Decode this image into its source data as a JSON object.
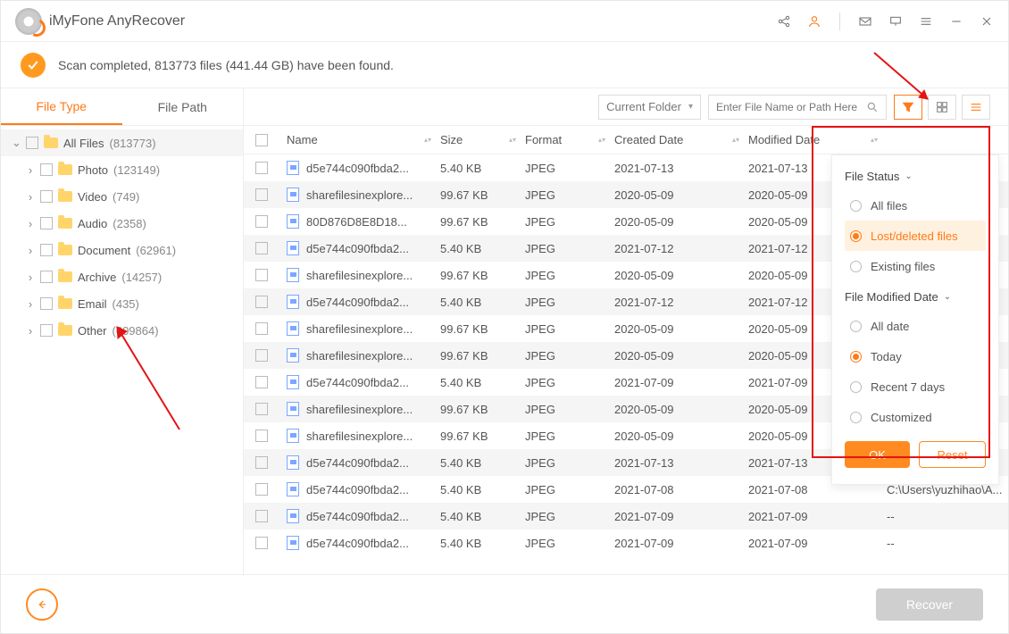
{
  "header": {
    "title": "iMyFone AnyRecover"
  },
  "status": {
    "text": "Scan completed, 813773 files (441.44 GB) have been found."
  },
  "tabs": {
    "fileType": "File Type",
    "filePath": "File Path"
  },
  "toolbar": {
    "scope": "Current Folder",
    "searchPlaceholder": "Enter File Name or Path Here"
  },
  "sidebar": {
    "root": {
      "label": "All Files",
      "count": "(813773)"
    },
    "items": [
      {
        "label": "Photo",
        "count": "(123149)"
      },
      {
        "label": "Video",
        "count": "(749)"
      },
      {
        "label": "Audio",
        "count": "(2358)"
      },
      {
        "label": "Document",
        "count": "(62961)"
      },
      {
        "label": "Archive",
        "count": "(14257)"
      },
      {
        "label": "Email",
        "count": "(435)"
      },
      {
        "label": "Other",
        "count": "(609864)"
      }
    ]
  },
  "columns": {
    "name": "Name",
    "size": "Size",
    "format": "Format",
    "created": "Created Date",
    "modified": "Modified Date"
  },
  "rows": [
    {
      "name": "d5e744c090fbda2...",
      "size": "5.40 KB",
      "format": "JPEG",
      "created": "2021-07-13",
      "modified": "2021-07-13",
      "path": ""
    },
    {
      "name": "sharefilesinexplore...",
      "size": "99.67 KB",
      "format": "JPEG",
      "created": "2020-05-09",
      "modified": "2020-05-09",
      "path": ""
    },
    {
      "name": "80D876D8E8D18...",
      "size": "99.67 KB",
      "format": "JPEG",
      "created": "2020-05-09",
      "modified": "2020-05-09",
      "path": ""
    },
    {
      "name": "d5e744c090fbda2...",
      "size": "5.40 KB",
      "format": "JPEG",
      "created": "2021-07-12",
      "modified": "2021-07-12",
      "path": ""
    },
    {
      "name": "sharefilesinexplore...",
      "size": "99.67 KB",
      "format": "JPEG",
      "created": "2020-05-09",
      "modified": "2020-05-09",
      "path": ""
    },
    {
      "name": "d5e744c090fbda2...",
      "size": "5.40 KB",
      "format": "JPEG",
      "created": "2021-07-12",
      "modified": "2021-07-12",
      "path": ""
    },
    {
      "name": "sharefilesinexplore...",
      "size": "99.67 KB",
      "format": "JPEG",
      "created": "2020-05-09",
      "modified": "2020-05-09",
      "path": ""
    },
    {
      "name": "sharefilesinexplore...",
      "size": "99.67 KB",
      "format": "JPEG",
      "created": "2020-05-09",
      "modified": "2020-05-09",
      "path": ""
    },
    {
      "name": "d5e744c090fbda2...",
      "size": "5.40 KB",
      "format": "JPEG",
      "created": "2021-07-09",
      "modified": "2021-07-09",
      "path": ""
    },
    {
      "name": "sharefilesinexplore...",
      "size": "99.67 KB",
      "format": "JPEG",
      "created": "2020-05-09",
      "modified": "2020-05-09",
      "path": ""
    },
    {
      "name": "sharefilesinexplore...",
      "size": "99.67 KB",
      "format": "JPEG",
      "created": "2020-05-09",
      "modified": "2020-05-09",
      "path": ""
    },
    {
      "name": "d5e744c090fbda2...",
      "size": "5.40 KB",
      "format": "JPEG",
      "created": "2021-07-13",
      "modified": "2021-07-13",
      "path": ""
    },
    {
      "name": "d5e744c090fbda2...",
      "size": "5.40 KB",
      "format": "JPEG",
      "created": "2021-07-08",
      "modified": "2021-07-08",
      "path": "C:\\Users\\yuzhihao\\A..."
    },
    {
      "name": "d5e744c090fbda2...",
      "size": "5.40 KB",
      "format": "JPEG",
      "created": "2021-07-09",
      "modified": "2021-07-09",
      "path": "--"
    },
    {
      "name": "d5e744c090fbda2...",
      "size": "5.40 KB",
      "format": "JPEG",
      "created": "2021-07-09",
      "modified": "2021-07-09",
      "path": "--"
    }
  ],
  "filter": {
    "statusTitle": "File Status",
    "status": {
      "all": "All files",
      "lost": "Lost/deleted files",
      "exist": "Existing files"
    },
    "dateTitle": "File Modified Date",
    "date": {
      "all": "All date",
      "today": "Today",
      "week": "Recent 7 days",
      "custom": "Customized"
    },
    "ok": "OK",
    "reset": "Reset"
  },
  "footer": {
    "recover": "Recover"
  }
}
